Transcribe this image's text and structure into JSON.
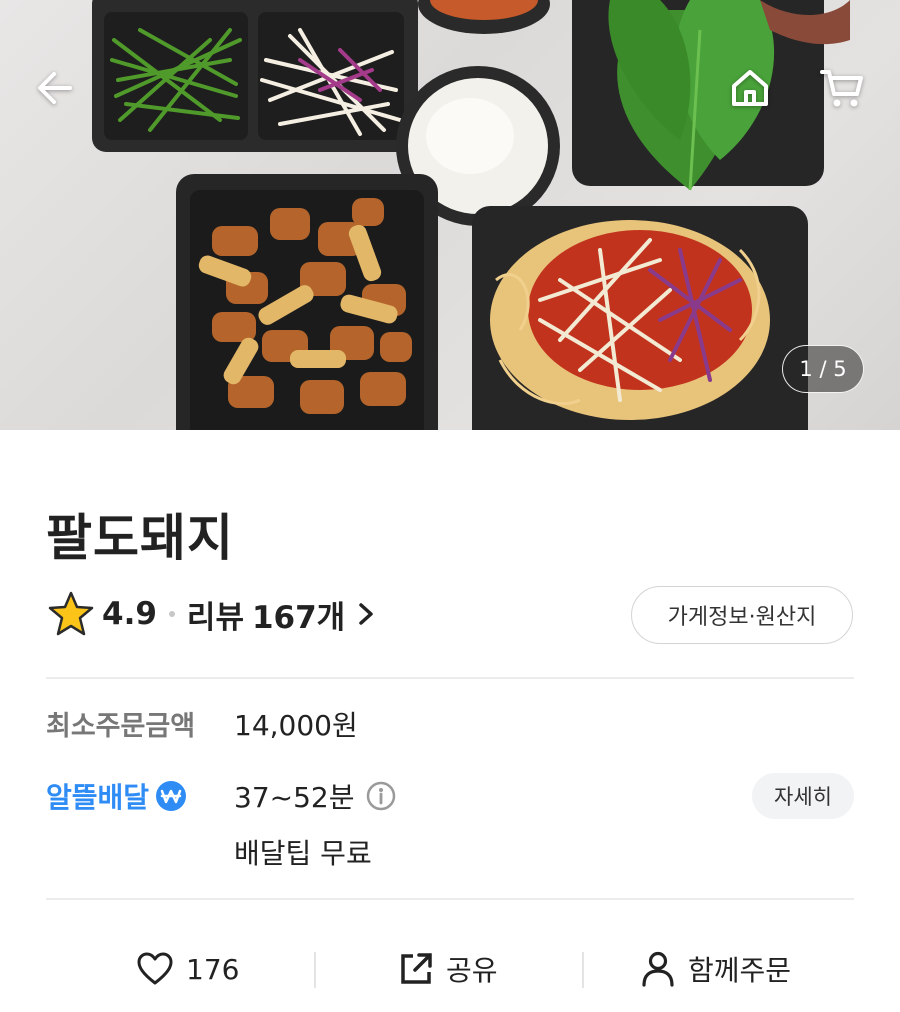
{
  "hero": {
    "counter": "1 / 5",
    "icons": {
      "back": "back-arrow-icon",
      "home": "home-icon",
      "cart": "cart-icon"
    }
  },
  "store": {
    "name": "팔도돼지",
    "rating": "4.9",
    "review_label": "리뷰",
    "review_count": "167개",
    "info_button": "가게정보·원산지"
  },
  "order_info": {
    "min_order_label": "최소주문금액",
    "min_order_value": "14,000원",
    "delivery_type": "알뜰배달",
    "delivery_time": "37~52분",
    "delivery_tip": "배달팁 무료",
    "detail_button": "자세히"
  },
  "actions": {
    "like_count": "176",
    "share_label": "공유",
    "group_order_label": "함께주문"
  },
  "colors": {
    "accent_blue": "#2f8cf5",
    "star_yellow": "#fcc419",
    "text_dark": "#222222",
    "text_gray": "#777777"
  }
}
